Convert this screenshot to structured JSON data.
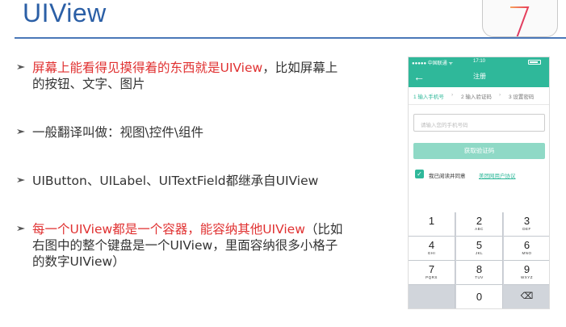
{
  "slide": {
    "title": "UIView"
  },
  "bullets": [
    {
      "text": "屏幕上能看得见摸得着的东西就是UIView",
      "text_rest": "，比如屏幕上",
      "line2": "的按钮、文字、图片"
    },
    {
      "text": "一般翻译叫做：视图\\控件\\组件"
    },
    {
      "text": "UIButton、UILabel、UITextField都继承自UIView"
    },
    {
      "text": "每一个UIView都是一个容器，能容纳其他UIView",
      "text_rest": "（比如",
      "line2": "右图中的整个键盘是一个UIView，里面容纳很多小格子",
      "line3": "的数字UIView）"
    }
  ],
  "phone": {
    "status": {
      "carrier": "●●●●● 中国联通 ᯤ",
      "time": "17:10"
    },
    "nav_title": "注册",
    "back_glyph": "←",
    "steps": [
      "1 输入手机号",
      "2 输入验证码",
      "3 设置密码"
    ],
    "step_arrow": "›",
    "input_placeholder": "请输入您的手机号码",
    "code_button": "获取验证码",
    "agree_text": "我已阅读并同意",
    "agree_link": "美团网用户协议",
    "check_glyph": "✓",
    "keys": [
      {
        "num": "1",
        "sub": ""
      },
      {
        "num": "2",
        "sub": "ABC"
      },
      {
        "num": "3",
        "sub": "DEF"
      },
      {
        "num": "4",
        "sub": "GHI"
      },
      {
        "num": "5",
        "sub": "JKL"
      },
      {
        "num": "6",
        "sub": "MNO"
      },
      {
        "num": "7",
        "sub": "PQRS"
      },
      {
        "num": "8",
        "sub": "TUV"
      },
      {
        "num": "9",
        "sub": "WXYZ"
      },
      {
        "num": "0",
        "sub": ""
      }
    ],
    "delete_glyph": "⌫"
  },
  "colors": {
    "accent": "#2fb89a",
    "title_blue": "#2b5fa6",
    "highlight_red": "#e03131"
  }
}
